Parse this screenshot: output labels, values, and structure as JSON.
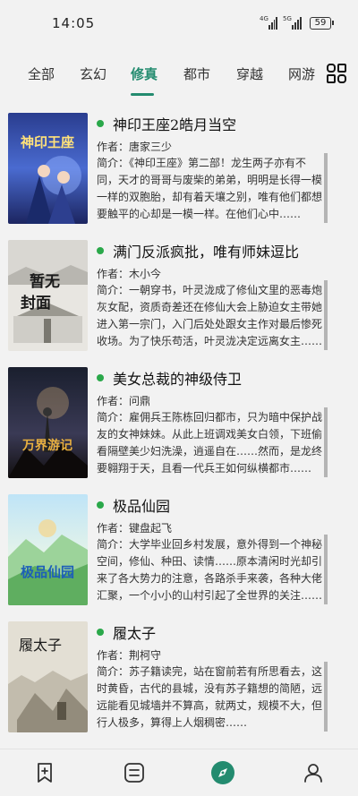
{
  "status": {
    "time": "14:05",
    "signal1_label": "4G",
    "signal2_label": "5G",
    "battery": "59"
  },
  "tabs": [
    {
      "label": "全部"
    },
    {
      "label": "玄幻"
    },
    {
      "label": "修真"
    },
    {
      "label": "都市"
    },
    {
      "label": "穿越"
    },
    {
      "label": "网游"
    }
  ],
  "active_tab": "修真",
  "books": [
    {
      "title": "神印王座2皓月当空",
      "author_prefix": "作者：",
      "author": "唐家三少",
      "intro": "简介：《神印王座》第二部！龙生两子亦有不同，天才的哥哥与废柴的弟弟，明明是长得一模一样的双胞胎，却有着天壤之别，唯有他们都想要触平的心却是一模一样。在他们心中……",
      "cover_text": "神印王座"
    },
    {
      "title": "满门反派疯批，唯有师妹逗比",
      "author_prefix": "作者：",
      "author": "木小今",
      "intro": "简介：一朝穿书，叶灵泷成了修仙文里的恶毒炮灰女配，资质奇差还在修仙大会上胁迫女主带她进入第一宗门，入门后处处跟女主作对最后惨死收场。为了快乐苟活，叶灵泷决定远离女主……",
      "cover_text": "暂无封面"
    },
    {
      "title": "美女总裁的神级侍卫",
      "author_prefix": "作者：",
      "author": "问鼎",
      "intro": "简介：雇佣兵王陈栋回归都市，只为暗中保护战友的女神妹妹。从此上班调戏美女白领，下班偷看隔壁美少妇洗澡，逍遥自在……然而，是龙终要翱翔于天，且看一代兵王如何纵横都市……",
      "cover_text": "万界游记"
    },
    {
      "title": "极品仙园",
      "author_prefix": "作者：",
      "author": "键盘起飞",
      "intro": "简介：大学毕业回乡村发展，意外得到一个神秘空间，修仙、种田、读情……原本清闲时光却引来了各大势力的注意，各路杀手来袭，各种大佬汇聚，一个小小的山村引起了全世界的关注……",
      "cover_text": "极品仙园"
    },
    {
      "title": "履太子",
      "author_prefix": "作者：",
      "author": "荆柯守",
      "intro": "简介：苏子籍读完，站在窗前若有所思看去，这时黄昏，古代的县城，没有苏子籍想的简陋，远远能看见城墙并不算高，就两丈，规模不大，但行人极多，算得上人烟稠密……",
      "cover_text": "履太子"
    }
  ],
  "bottom_nav": [
    {
      "icon": "bookshelf-icon"
    },
    {
      "icon": "library-icon"
    },
    {
      "icon": "discover-icon"
    },
    {
      "icon": "profile-icon"
    }
  ],
  "colors": {
    "accent": "#238b6f",
    "dot": "#2aa84a",
    "background": "#f2f2f2"
  }
}
